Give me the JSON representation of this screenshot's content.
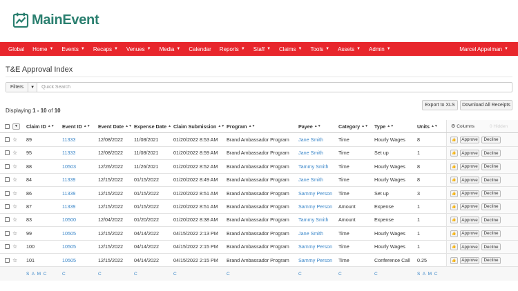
{
  "brand": {
    "name": "MainEvent",
    "color": "#2a7f6f"
  },
  "nav": {
    "items": [
      {
        "label": "Global",
        "caret": false
      },
      {
        "label": "Home",
        "caret": true
      },
      {
        "label": "Events",
        "caret": true
      },
      {
        "label": "Recaps",
        "caret": true
      },
      {
        "label": "Venues",
        "caret": true
      },
      {
        "label": "Media",
        "caret": true
      },
      {
        "label": "Calendar",
        "caret": false
      },
      {
        "label": "Reports",
        "caret": true
      },
      {
        "label": "Staff",
        "caret": true
      },
      {
        "label": "Claims",
        "caret": true
      },
      {
        "label": "Tools",
        "caret": true
      },
      {
        "label": "Assets",
        "caret": true
      },
      {
        "label": "Admin",
        "caret": true
      }
    ],
    "user": "Marcel Appelman",
    "bg_color": "#e8262c"
  },
  "page": {
    "title": "T&E Approval Index"
  },
  "filters": {
    "label": "Filters",
    "search_placeholder": "Quick Search"
  },
  "summary": {
    "prefix": "Displaying ",
    "from": "1",
    "sep": " - ",
    "to": "10",
    "of_text": " of ",
    "total": "10"
  },
  "toolbar": {
    "export_label": "Export to XLS",
    "download_label": "Download All Receipts"
  },
  "table": {
    "headers": {
      "claim_id": "Claim ID",
      "event_id": "Event ID",
      "event_date": "Event Date",
      "expense_date": "Expense Date",
      "claim_submission": "Claim Submission",
      "program": "Program",
      "payee": "Payee",
      "category": "Category",
      "type": "Type",
      "units": "Units",
      "columns": "Columns",
      "hidden": "0 Hidden"
    },
    "rows": [
      {
        "claim_id": "89",
        "event_id": "11333",
        "event_date": "12/08/2022",
        "expense_date": "11/08/2021",
        "claim_submission": "01/20/2022 8:53 AM",
        "program": "Brand Ambassador Program",
        "payee": "Jane Smith",
        "category": "Time",
        "type": "Hourly Wages",
        "units": "8"
      },
      {
        "claim_id": "95",
        "event_id": "11333",
        "event_date": "12/08/2022",
        "expense_date": "11/08/2021",
        "claim_submission": "01/20/2022 8:59 AM",
        "program": "Brand Ambassador Program",
        "payee": "Jane Smith",
        "category": "Time",
        "type": "Set up",
        "units": "1"
      },
      {
        "claim_id": "88",
        "event_id": "10503",
        "event_date": "12/26/2022",
        "expense_date": "11/26/2021",
        "claim_submission": "01/20/2022 8:52 AM",
        "program": "Brand Ambassador Program",
        "payee": "Tammy Smith",
        "category": "Time",
        "type": "Hourly Wages",
        "units": "8"
      },
      {
        "claim_id": "84",
        "event_id": "11339",
        "event_date": "12/15/2022",
        "expense_date": "01/15/2022",
        "claim_submission": "01/20/2022 8:49 AM",
        "program": "Brand Ambassador Program",
        "payee": "Jane Smith",
        "category": "Time",
        "type": "Hourly Wages",
        "units": "8"
      },
      {
        "claim_id": "86",
        "event_id": "11339",
        "event_date": "12/15/2022",
        "expense_date": "01/15/2022",
        "claim_submission": "01/20/2022 8:51 AM",
        "program": "Brand Ambassador Program",
        "payee": "Sammy Person",
        "category": "Time",
        "type": "Set up",
        "units": "3"
      },
      {
        "claim_id": "87",
        "event_id": "11339",
        "event_date": "12/15/2022",
        "expense_date": "01/15/2022",
        "claim_submission": "01/20/2022 8:51 AM",
        "program": "Brand Ambassador Program",
        "payee": "Sammy Person",
        "category": "Amount",
        "type": "Expense",
        "units": "1"
      },
      {
        "claim_id": "83",
        "event_id": "10500",
        "event_date": "12/04/2022",
        "expense_date": "01/20/2022",
        "claim_submission": "01/20/2022 8:38 AM",
        "program": "Brand Ambassador Program",
        "payee": "Tammy Smith",
        "category": "Amount",
        "type": "Expense",
        "units": "1"
      },
      {
        "claim_id": "99",
        "event_id": "10505",
        "event_date": "12/15/2022",
        "expense_date": "04/14/2022",
        "claim_submission": "04/15/2022 2:13 PM",
        "program": "Brand Ambassador Program",
        "payee": "Jane Smith",
        "category": "Time",
        "type": "Hourly Wages",
        "units": "1"
      },
      {
        "claim_id": "100",
        "event_id": "10505",
        "event_date": "12/15/2022",
        "expense_date": "04/14/2022",
        "claim_submission": "04/15/2022 2:15 PM",
        "program": "Brand Ambassador Program",
        "payee": "Sammy Person",
        "category": "Time",
        "type": "Hourly Wages",
        "units": "1"
      },
      {
        "claim_id": "101",
        "event_id": "10505",
        "event_date": "12/15/2022",
        "expense_date": "04/14/2022",
        "claim_submission": "04/15/2022 2:15 PM",
        "program": "Brand Ambassador Program",
        "payee": "Sammy Person",
        "category": "Time",
        "type": "Conference Call",
        "units": "0.25"
      }
    ],
    "row_actions": {
      "thumb_icon": "thumbs-up-icon",
      "approve_label": "Approve",
      "decline_label": "Decline"
    },
    "footer": {
      "claim_id": "S A M C",
      "event_id": "C",
      "event_date": "C",
      "expense_date": "C",
      "claim_submission": "C",
      "program": "C",
      "payee": "C",
      "category": "C",
      "type": "C",
      "units": "S A M C"
    }
  },
  "colors": {
    "link": "#3a86c8"
  }
}
